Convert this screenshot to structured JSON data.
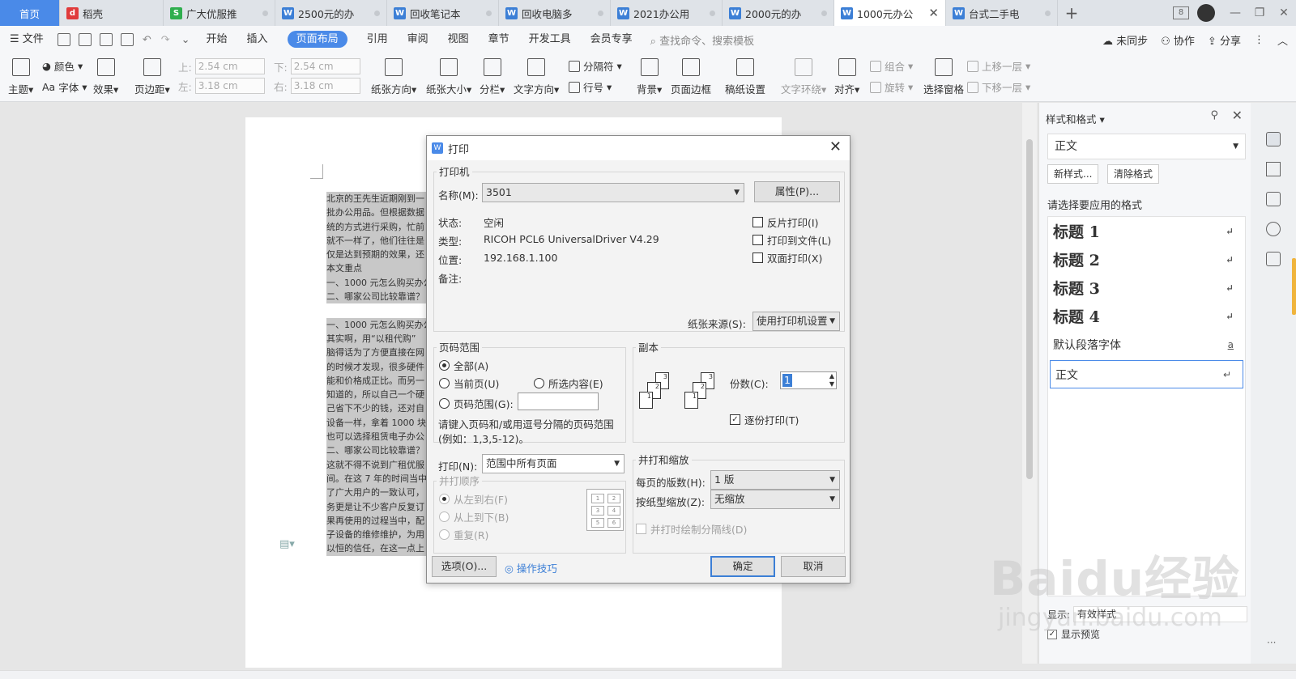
{
  "tabs": [
    {
      "label": "首页",
      "kind": "home"
    },
    {
      "label": "稻壳",
      "kind": "docer",
      "color": "#e03b3b",
      "icon": "d"
    },
    {
      "label": "广大优服推",
      "kind": "sheet",
      "color": "#2fae4e",
      "icon": "S"
    },
    {
      "label": "2500元的办",
      "kind": "writer",
      "color": "#3c7fd6",
      "icon": "W"
    },
    {
      "label": "回收笔记本",
      "kind": "writer",
      "color": "#3c7fd6",
      "icon": "W"
    },
    {
      "label": "回收电脑多",
      "kind": "writer",
      "color": "#3c7fd6",
      "icon": "W"
    },
    {
      "label": "2021办公用",
      "kind": "writer",
      "color": "#3c7fd6",
      "icon": "W"
    },
    {
      "label": "2000元的办",
      "kind": "writer",
      "color": "#3c7fd6",
      "icon": "W"
    },
    {
      "label": "1000元办公",
      "kind": "writer-active",
      "color": "#3c7fd6",
      "icon": "W"
    },
    {
      "label": "台式二手电",
      "kind": "writer",
      "color": "#3c7fd6",
      "icon": "W"
    }
  ],
  "window": {
    "badge": "8",
    "minimize": "—",
    "restore": "❐",
    "close": "✕"
  },
  "menu": {
    "file": "文件",
    "items": [
      "开始",
      "插入",
      "页面布局",
      "引用",
      "审阅",
      "视图",
      "章节",
      "开发工具",
      "会员专享"
    ],
    "active_index": 2,
    "search_placeholder": "查找命令、搜索模板",
    "right": [
      "未同步",
      "协作",
      "分享"
    ]
  },
  "ribbon": {
    "theme": "主题",
    "colors": "颜色",
    "fonts": "字体",
    "effects": "效果",
    "margins": "页边距",
    "margin_top_label": "上:",
    "margin_top": "2.54 cm",
    "margin_bottom_label": "下:",
    "margin_bottom": "2.54 cm",
    "margin_left_label": "左:",
    "margin_left": "3.18 cm",
    "margin_right_label": "右:",
    "margin_right": "3.18 cm",
    "orientation": "纸张方向",
    "size": "纸张大小",
    "columns": "分栏",
    "text_direction": "文字方向",
    "breaks": "分隔符",
    "line_numbers": "行号",
    "background": "背景",
    "page_border": "页面边框",
    "grid_paper": "稿纸设置",
    "text_wrap": "文字环绕",
    "align": "对齐",
    "group": "组合",
    "rotate": "旋转",
    "selection_pane": "选择窗格",
    "bring_forward": "上移一层",
    "send_backward": "下移一层"
  },
  "document": {
    "lines": [
      "北京的王先生近期刚到一",
      "批办公用品。但根据数据",
      "统的方式进行采购，忙前",
      "就不一样了，他们往往是",
      "仅是达到预期的效果，还",
      "本文重点",
      "一、1000 元怎么购买办公",
      "二、哪家公司比较靠谱？",
      "",
      "一、1000 元怎么购买办公",
      "其实啊，用“以租代购”",
      "脑得话为了方便直接在网",
      "的时候才发现，很多硬件",
      "能和价格成正比。而另一",
      "知道的，所以自己一个硬",
      "己省下不少的钱，还对自",
      "设备一样，拿着 1000 块",
      "也可以选择租赁电子办公",
      "二、哪家公司比较靠谱？",
      "这就不得不说到广租优服",
      "间。在这 7 年的时间当中",
      "了广大用户的一致认可，",
      "务更是让不少客户反复订",
      "果再使用的过程当中，配",
      "子设备的维修维护，为用",
      "以恒的信任，在这一点上"
    ]
  },
  "side_panel": {
    "title": "样式和格式",
    "current_style": "正文",
    "new_style": "新样式...",
    "clear_format": "清除格式",
    "prompt": "请选择要应用的格式",
    "styles": [
      {
        "label": "标题  1",
        "kind": "heading",
        "mark": "↵"
      },
      {
        "label": "标题  2",
        "kind": "heading",
        "mark": "↵"
      },
      {
        "label": "标题  3",
        "kind": "heading",
        "mark": "↵"
      },
      {
        "label": "标题  4",
        "kind": "heading",
        "mark": "↵"
      },
      {
        "label": "默认段落字体",
        "kind": "plain",
        "mark": "a"
      },
      {
        "label": "正文",
        "kind": "selected",
        "mark": "↵"
      }
    ],
    "show_label": "显示:",
    "show_value": "有效样式",
    "preview_label": "显示预览",
    "preview_checked": true
  },
  "print_dialog": {
    "title": "打印",
    "printer_group": "打印机",
    "name_label": "名称(M):",
    "name_value": "3501",
    "properties_button": "属性(P)...",
    "status_label": "状态:",
    "status_value": "空闲",
    "type_label": "类型:",
    "type_value": "RICOH PCL6 UniversalDriver V4.29",
    "location_label": "位置:",
    "location_value": "192.168.1.100",
    "comment_label": "备注:",
    "reverse_print": "反片打印(I)",
    "print_to_file": "打印到文件(L)",
    "duplex": "双面打印(X)",
    "paper_source_label": "纸张来源(S):",
    "paper_source_value": "使用打印机设置",
    "page_range_group": "页码范围",
    "all": "全部(A)",
    "current_page": "当前页(U)",
    "selection": "所选内容(E)",
    "page_range": "页码范围(G):",
    "page_range_value": "",
    "page_range_hint": "请键入页码和/或用逗号分隔的页码范围",
    "page_range_example": "(例如：1,3,5-12)。",
    "copies_group": "副本",
    "copies_label": "份数(C):",
    "copies_value": "1",
    "collate": "逐份打印(T)",
    "collate_checked": true,
    "print_label": "打印(N):",
    "print_value": "范围中所有页面",
    "order_group": "并打顺序",
    "order_lr": "从左到右(F)",
    "order_tb": "从上到下(B)",
    "order_repeat": "重复(R)",
    "scale_group": "并打和缩放",
    "pages_per_sheet_label": "每页的版数(H):",
    "pages_per_sheet_value": "1 版",
    "scale_label": "按纸型缩放(Z):",
    "scale_value": "无缩放",
    "draw_borders": "并打时绘制分隔线(D)",
    "options_button": "选项(O)...",
    "tips_link": "操作技巧",
    "ok_button": "确定",
    "cancel_button": "取消"
  },
  "watermark": {
    "brand": "Baidu经验",
    "url": "jingyan.baidu.com"
  },
  "colors": {
    "accent": "#4a8ae8",
    "highlight": "#f0b43c"
  }
}
